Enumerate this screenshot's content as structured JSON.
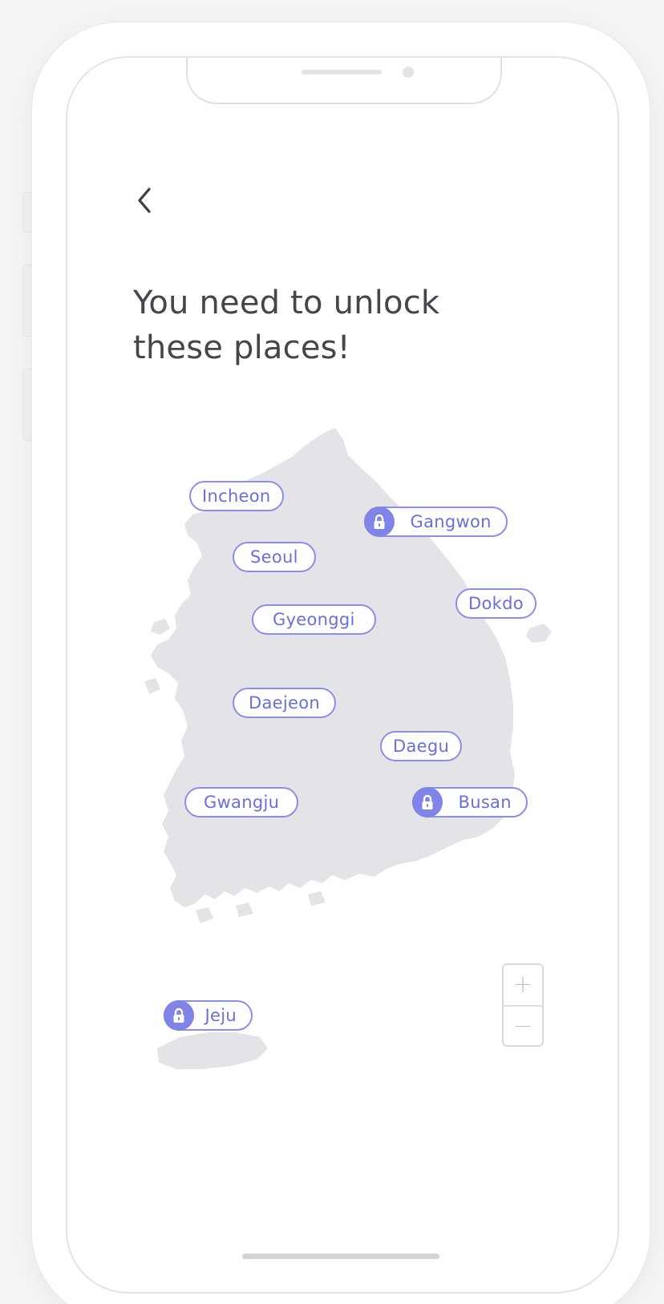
{
  "header": {
    "back_icon": "chevron-left-icon",
    "title_line1": "You need to unlock",
    "title_line2": "these places!"
  },
  "map": {
    "region": "south-korea-map",
    "fill_color": "#e4e4e8",
    "places": [
      {
        "id": "incheon",
        "label": "Incheon",
        "locked": false
      },
      {
        "id": "gangwon",
        "label": "Gangwon",
        "locked": true
      },
      {
        "id": "seoul",
        "label": "Seoul",
        "locked": false
      },
      {
        "id": "dokdo",
        "label": "Dokdo",
        "locked": false
      },
      {
        "id": "gyeonggi",
        "label": "Gyeonggi",
        "locked": false
      },
      {
        "id": "daejeon",
        "label": "Daejeon",
        "locked": false
      },
      {
        "id": "daegu",
        "label": "Daegu",
        "locked": false
      },
      {
        "id": "gwangju",
        "label": "Gwangju",
        "locked": false
      },
      {
        "id": "busan",
        "label": "Busan",
        "locked": true
      },
      {
        "id": "jeju",
        "label": "Jeju",
        "locked": true
      }
    ]
  },
  "zoom": {
    "zoom_in_label": "+",
    "zoom_out_label": "−"
  },
  "colors": {
    "accent": "#8a8ee8",
    "accent_text": "#6a6fdc",
    "lock_fill": "#7f84e6",
    "title_text": "#45454c"
  }
}
